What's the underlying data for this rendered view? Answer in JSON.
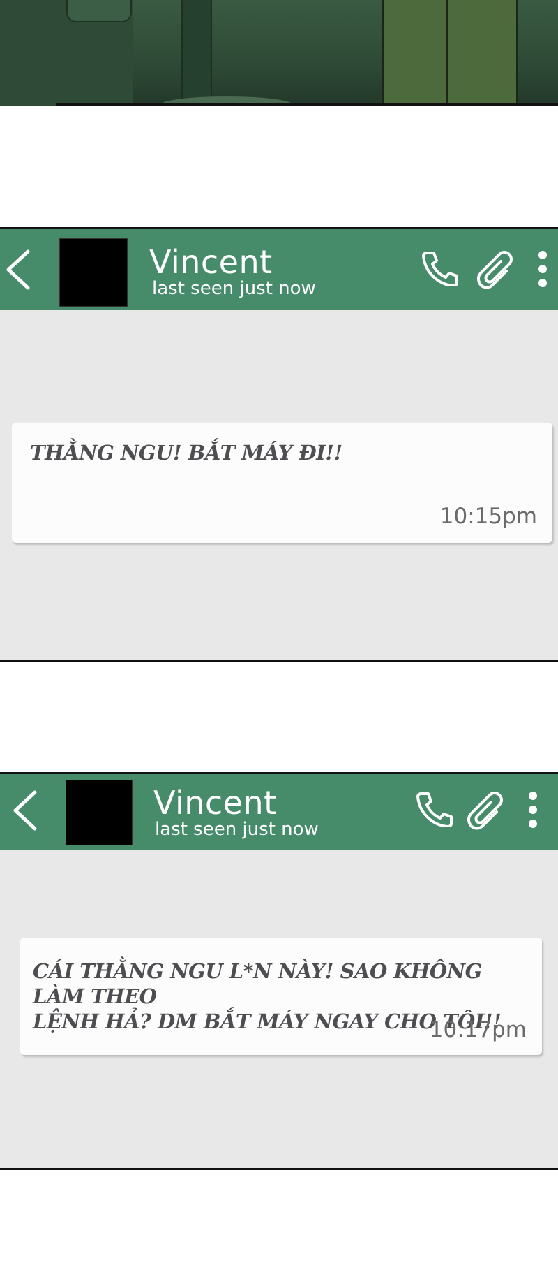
{
  "colors": {
    "header_green": "#478c6a",
    "chat_background": "#e8e8e8",
    "bubble_background": "#fcfcfc",
    "message_text": "#4e4e52",
    "time_text": "#6a6a6a"
  },
  "screens": [
    {
      "header": {
        "back_icon": "chevron-left-icon",
        "contact_name": "Vincent",
        "status": "last seen just now",
        "call_icon": "phone-icon",
        "attach_icon": "paperclip-icon",
        "menu_icon": "more-vertical-icon"
      },
      "message": {
        "text": "THẰNG NGU! BẮT MÁY ĐI!!",
        "time": "10:15pm"
      }
    },
    {
      "header": {
        "back_icon": "chevron-left-icon",
        "contact_name": "Vincent",
        "status": "last seen just now",
        "call_icon": "phone-icon",
        "attach_icon": "paperclip-icon",
        "menu_icon": "more-vertical-icon"
      },
      "message": {
        "text_line_1": "CÁI THẰNG NGU L*N NÀY! SAO KHÔNG LÀM THEO",
        "text_line_2": "LỆNH HẢ? DM BẮT MÁY NGAY CHO TÔI!!",
        "time": "10:17pm"
      }
    }
  ]
}
